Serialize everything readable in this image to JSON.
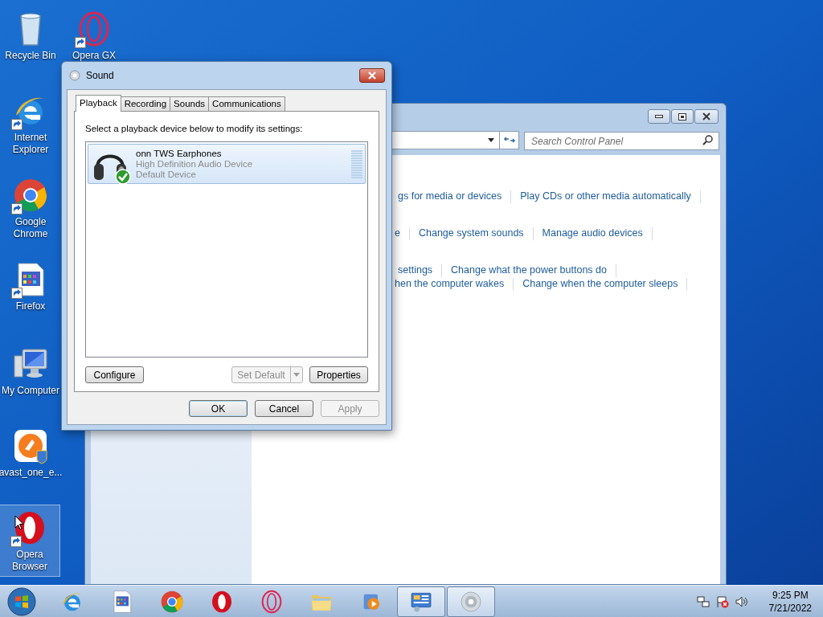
{
  "desktop_icons": [
    {
      "label": "Recycle Bin",
      "kind": "recycle",
      "shortcut": false,
      "selected": false
    },
    {
      "label": "Opera GX",
      "kind": "opera_gx",
      "shortcut": true,
      "selected": false
    },
    {
      "label": "Internet Explorer",
      "kind": "ie",
      "shortcut": true,
      "selected": false
    },
    {
      "label": "Google Chrome",
      "kind": "chrome",
      "shortcut": true,
      "selected": false
    },
    {
      "label": "Firefox",
      "kind": "doc",
      "shortcut": true,
      "selected": false
    },
    {
      "label": "My Computer",
      "kind": "computer",
      "shortcut": false,
      "selected": false
    },
    {
      "label": "avast_one_e...",
      "kind": "avast",
      "shortcut": false,
      "selected": false
    },
    {
      "label": "Opera Browser",
      "kind": "opera",
      "shortcut": true,
      "selected": true
    }
  ],
  "control_panel": {
    "search_placeholder": "Search Control Panel",
    "link_rows": [
      [
        "gs for media or devices",
        "Play CDs or other media automatically"
      ],
      [
        "e",
        "Change system sounds",
        "Manage audio devices"
      ],
      [
        "settings",
        "Change what the power buttons do"
      ],
      [
        "hen the computer wakes",
        "Change when the computer sleeps"
      ]
    ]
  },
  "sound_dialog": {
    "title": "Sound",
    "tabs": [
      {
        "label": "Playback",
        "selected": true
      },
      {
        "label": "Recording",
        "selected": false
      },
      {
        "label": "Sounds",
        "selected": false
      },
      {
        "label": "Communications",
        "selected": false
      }
    ],
    "instruction": "Select a playback device below to modify its settings:",
    "devices": [
      {
        "name": "onn TWS Earphones",
        "driver": "High Definition Audio Device",
        "status": "Default Device",
        "selected": true,
        "default": true,
        "level": 0
      }
    ],
    "panel_buttons": [
      {
        "label": "Configure",
        "kind": "plain",
        "disabled": false
      },
      {
        "label": "Set Default",
        "kind": "split",
        "disabled": true
      },
      {
        "label": "Properties",
        "kind": "plain",
        "disabled": false
      }
    ],
    "footer_buttons": [
      {
        "label": "OK",
        "default": true,
        "disabled": false
      },
      {
        "label": "Cancel",
        "default": false,
        "disabled": false
      },
      {
        "label": "Apply",
        "default": false,
        "disabled": true
      }
    ]
  },
  "taskbar": {
    "items": [
      {
        "kind": "ie",
        "active": false
      },
      {
        "kind": "doc",
        "active": false
      },
      {
        "kind": "chrome",
        "active": false
      },
      {
        "kind": "opera",
        "active": false
      },
      {
        "kind": "opera_gx",
        "active": false
      },
      {
        "kind": "folder",
        "active": false
      },
      {
        "kind": "media",
        "active": false
      },
      {
        "kind": "control_panel",
        "active": true
      },
      {
        "kind": "sound",
        "active": true
      }
    ],
    "time": "9:25 PM",
    "date": "7/21/2022"
  }
}
